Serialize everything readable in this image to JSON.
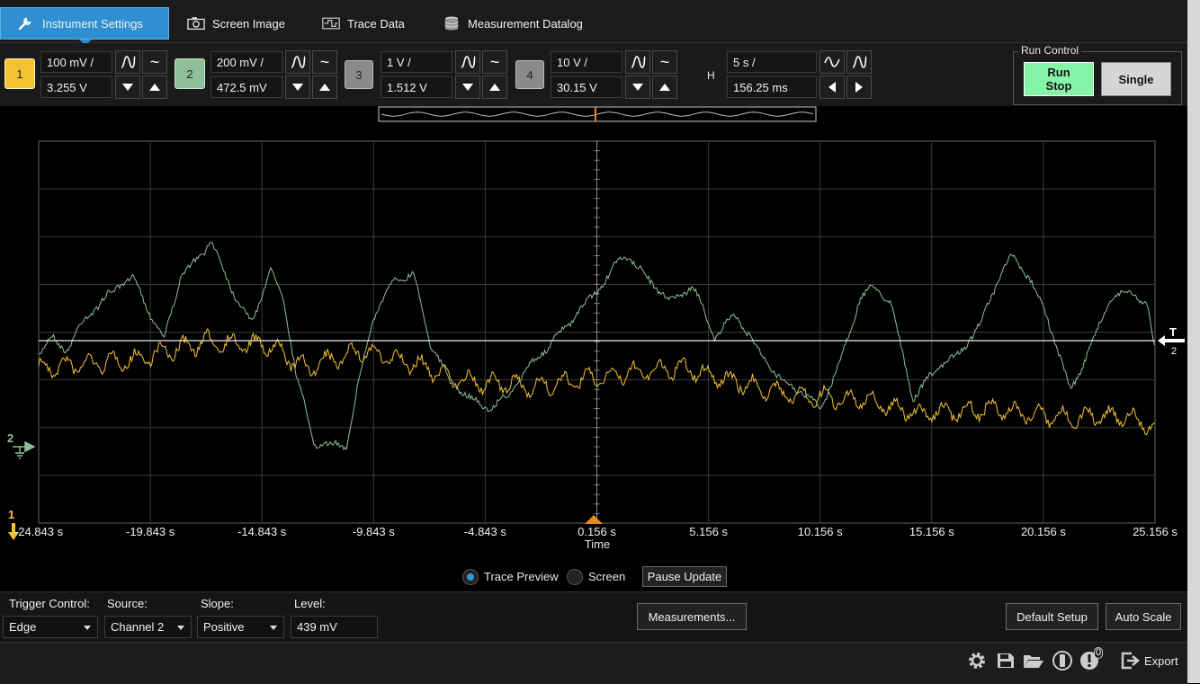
{
  "tabs": [
    {
      "label": "Instrument Settings",
      "icon": "wrench-icon",
      "active": true
    },
    {
      "label": "Screen Image",
      "icon": "camera-icon"
    },
    {
      "label": "Trace Data",
      "icon": "waveform-icon"
    },
    {
      "label": "Measurement Datalog",
      "icon": "database-icon"
    }
  ],
  "channels": [
    {
      "num": "1",
      "scale": "100 mV /",
      "offset": "3.255 V",
      "color": "#f5c332"
    },
    {
      "num": "2",
      "scale": "200 mV /",
      "offset": "472.5 mV",
      "color": "#8fbf98"
    },
    {
      "num": "3",
      "scale": "1 V /",
      "offset": "1.512 V",
      "color": "#8a8a8a"
    },
    {
      "num": "4",
      "scale": "10 V /",
      "offset": "30.15 V",
      "color": "#8a8a8a"
    }
  ],
  "horizontal": {
    "label": "H",
    "scale": "5 s /",
    "position": "156.25 ms"
  },
  "run_control": {
    "title": "Run Control",
    "run_stop_line1": "Run",
    "run_stop_line2": "Stop",
    "single": "Single",
    "run_color": "#86f4a8"
  },
  "scope": {
    "x_ticks": [
      "-24.843 s",
      "-19.843 s",
      "-14.843 s",
      "-9.843 s",
      "-4.843 s",
      "0.156 s",
      "5.156 s",
      "10.156 s",
      "15.156 s",
      "20.156 s",
      "25.156 s"
    ],
    "x_label": "Time",
    "trigger_marker": "T",
    "trigger_channel": "2",
    "ch2_marker": "2",
    "ch1_marker": "1"
  },
  "view": {
    "trace_preview": "Trace Preview",
    "screen": "Screen",
    "pause": "Pause Update"
  },
  "trigger": {
    "control_label": "Trigger Control:",
    "control_value": "Edge",
    "source_label": "Source:",
    "source_value": "Channel 2",
    "slope_label": "Slope:",
    "slope_value": "Positive",
    "level_label": "Level:",
    "level_value": "439 mV"
  },
  "buttons": {
    "measurements": "Measurements...",
    "default_setup": "Default Setup",
    "auto_scale": "Auto Scale"
  },
  "status": {
    "notifications": "0",
    "export": "Export"
  }
}
